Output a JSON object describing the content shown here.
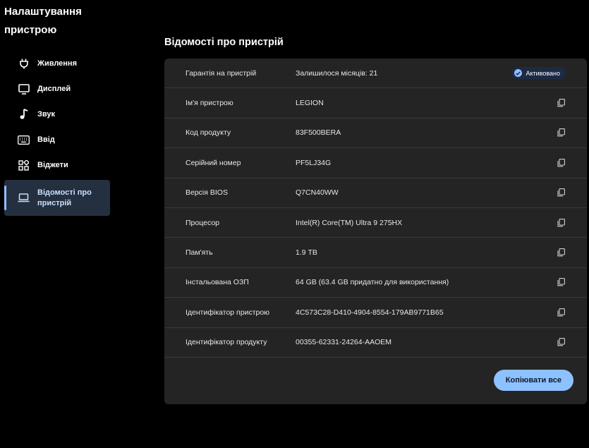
{
  "app": {
    "title": "Налаштування пристрою"
  },
  "sidebar": {
    "items": [
      {
        "label": "Живлення",
        "icon": "plug-icon"
      },
      {
        "label": "Дисплей",
        "icon": "monitor-icon"
      },
      {
        "label": "Звук",
        "icon": "music-note-icon"
      },
      {
        "label": "Ввід",
        "icon": "keyboard-icon"
      },
      {
        "label": "Віджети",
        "icon": "widgets-icon"
      },
      {
        "label": "Відомості про пристрій",
        "icon": "laptop-icon",
        "active": true
      }
    ]
  },
  "main": {
    "title": "Відомості про пристрій",
    "warranty": {
      "key": "Гарантія на пристрій",
      "value": "Залишилося місяців: 21",
      "badge": "Активовано"
    },
    "rows": [
      {
        "key": "Ім'я пристрою",
        "value": "LEGION"
      },
      {
        "key": "Код продукту",
        "value": "83F500BERA"
      },
      {
        "key": "Серійний номер",
        "value": "PF5LJ34G"
      },
      {
        "key": "Версія BIOS",
        "value": "Q7CN40WW"
      },
      {
        "key": "Процесор",
        "value": "Intel(R) Core(TM) Ultra 9 275HX"
      },
      {
        "key": "Пам'ять",
        "value": "1.9 ТВ"
      },
      {
        "key": "Інстальована ОЗП",
        "value": "64 GB (63.4 GB придатно для використання)"
      },
      {
        "key": "Ідентифікатор пристрою",
        "value": "4C573C28-D410-4904-8554-179AB9771B65"
      },
      {
        "key": "Ідентифікатор продукту",
        "value": "00355-62331-24264-AAOEM"
      }
    ],
    "copy_all_label": "Копіювати все"
  },
  "colors": {
    "accent": "#8ec1ff",
    "card": "#242424",
    "active_nav": "#24303f",
    "background": "#000000"
  }
}
